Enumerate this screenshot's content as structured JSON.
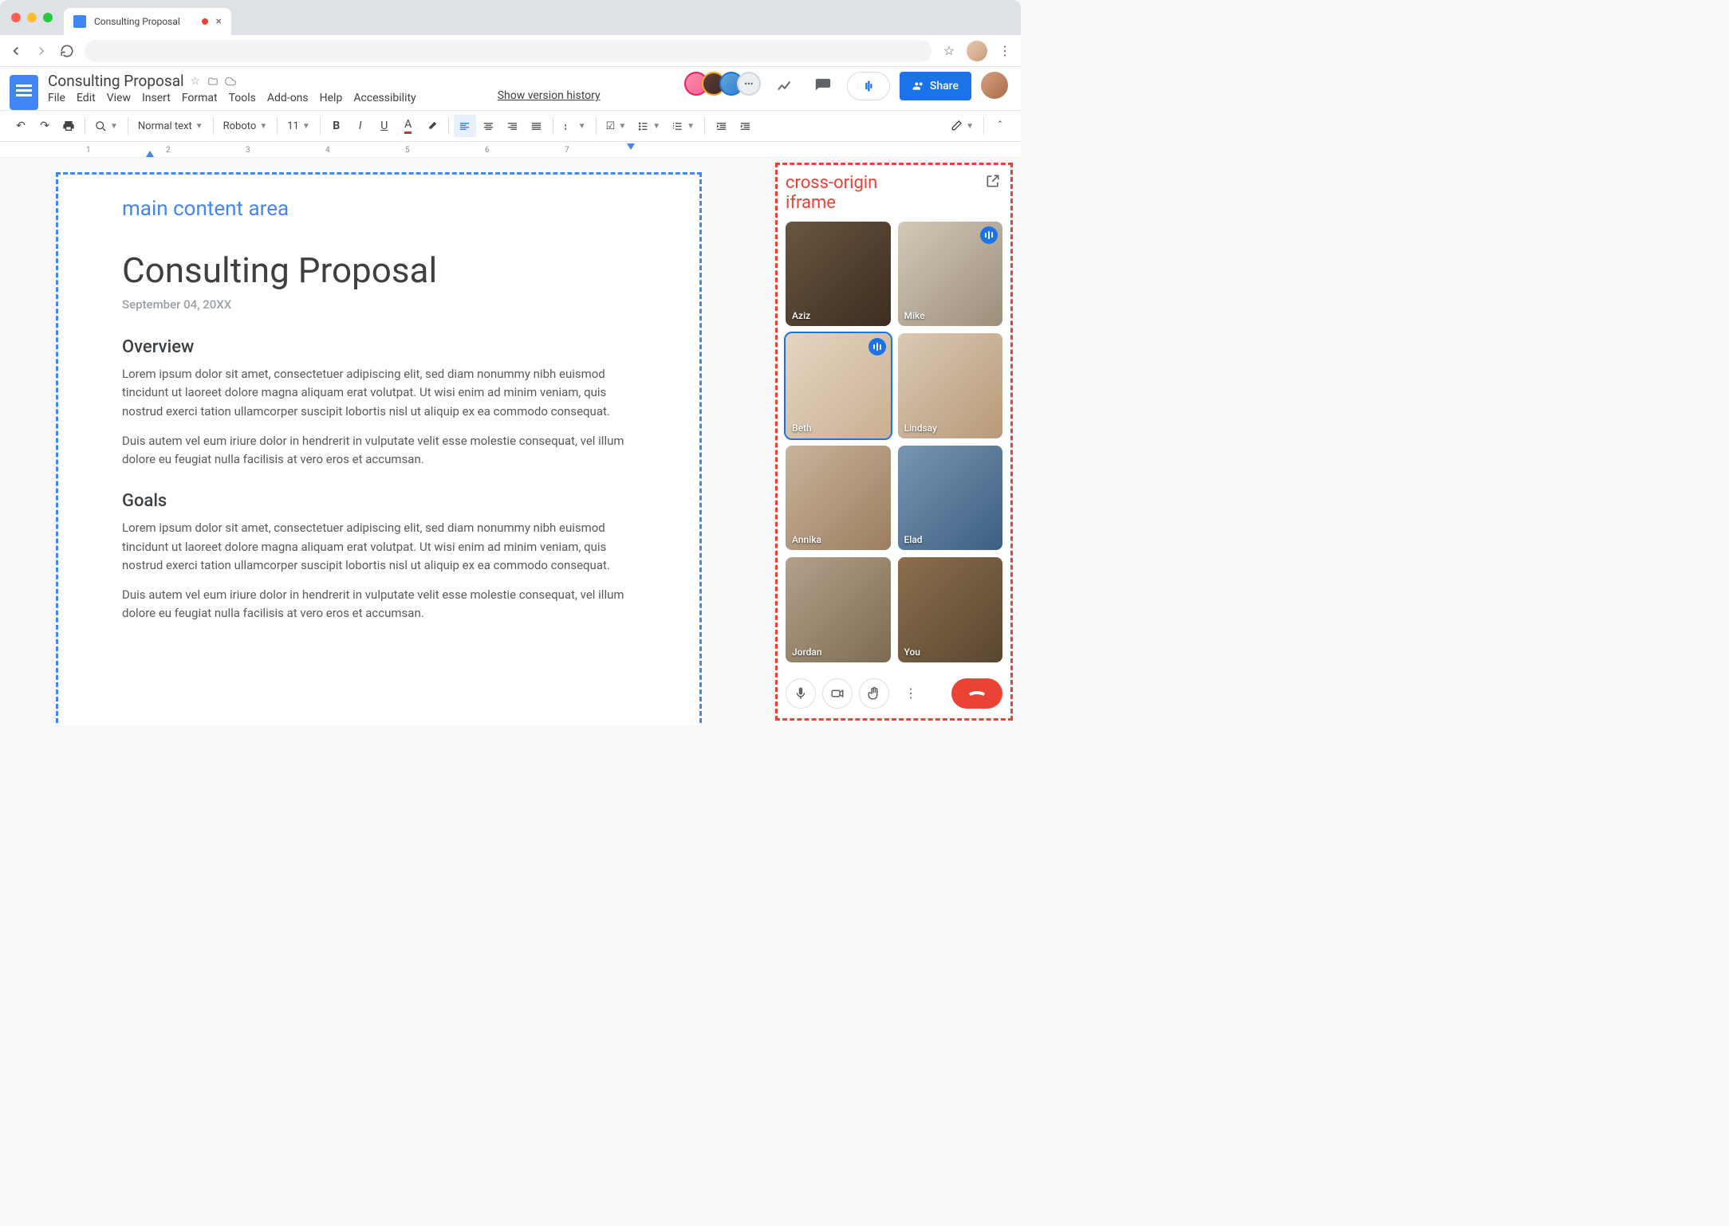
{
  "browser": {
    "tab_title": "Consulting Proposal",
    "tab_close": "×"
  },
  "docs": {
    "title": "Consulting Proposal",
    "menus": [
      "File",
      "Edit",
      "View",
      "Insert",
      "Format",
      "Tools",
      "Add-ons",
      "Help",
      "Accessibility"
    ],
    "version_link": "Show version history",
    "share_label": "Share",
    "collab_more": "•••"
  },
  "toolbar": {
    "style": "Normal text",
    "font": "Roboto",
    "size": "11"
  },
  "ruler": {
    "nums": [
      "1",
      "2",
      "3",
      "4",
      "5",
      "6",
      "7"
    ]
  },
  "annotations": {
    "main": "main content area",
    "iframe_l1": "cross-origin",
    "iframe_l2": "iframe"
  },
  "document": {
    "h1": "Consulting Proposal",
    "date": "September 04, 20XX",
    "sections": [
      {
        "heading": "Overview",
        "p1": "Lorem ipsum dolor sit amet, consectetuer adipiscing elit, sed diam nonummy nibh euismod tincidunt ut laoreet dolore magna aliquam erat volutpat. Ut wisi enim ad minim veniam, quis nostrud exerci tation ullamcorper suscipit lobortis nisl ut aliquip ex ea commodo consequat.",
        "p2": "Duis autem vel eum iriure dolor in hendrerit in vulputate velit esse molestie consequat, vel illum dolore eu feugiat nulla facilisis at vero eros et accumsan."
      },
      {
        "heading": "Goals",
        "p1": "Lorem ipsum dolor sit amet, consectetuer adipiscing elit, sed diam nonummy nibh euismod tincidunt ut laoreet dolore magna aliquam erat volutpat. Ut wisi enim ad minim veniam, quis nostrud exerci tation ullamcorper suscipit lobortis nisl ut aliquip ex ea commodo consequat.",
        "p2": "Duis autem vel eum iriure dolor in hendrerit in vulputate velit esse molestie consequat, vel illum dolore eu feugiat nulla facilisis at vero eros et accumsan."
      }
    ]
  },
  "meet": {
    "participants": [
      {
        "name": "Aziz",
        "speaking": false,
        "active": false
      },
      {
        "name": "Mike",
        "speaking": true,
        "active": false
      },
      {
        "name": "Beth",
        "speaking": true,
        "active": true
      },
      {
        "name": "Lindsay",
        "speaking": false,
        "active": false
      },
      {
        "name": "Annika",
        "speaking": false,
        "active": false
      },
      {
        "name": "Elad",
        "speaking": false,
        "active": false
      },
      {
        "name": "Jordan",
        "speaking": false,
        "active": false
      },
      {
        "name": "You",
        "speaking": false,
        "active": false
      }
    ]
  }
}
